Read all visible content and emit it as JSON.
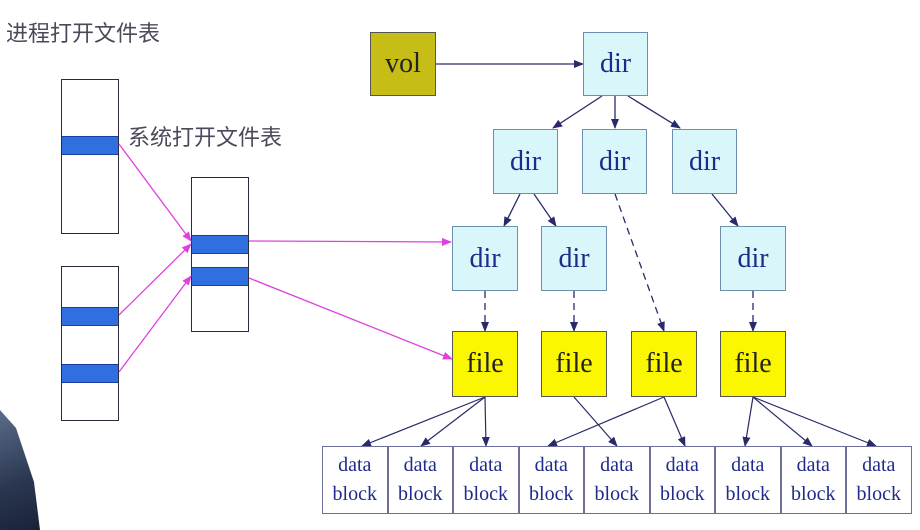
{
  "labels": {
    "process_table": "进程打开文件表",
    "system_table": "系统打开文件表"
  },
  "nodes": {
    "vol": "vol",
    "dir": "dir",
    "file": "file"
  },
  "block": {
    "line1": "data",
    "line2": "block"
  },
  "colors": {
    "vol": "#c7bd17",
    "dir": "#d9f7fb",
    "file": "#fbf700",
    "slot": "#2f6fe0",
    "pointer": "#e040e0",
    "tree_line": "#2a2a6a"
  }
}
